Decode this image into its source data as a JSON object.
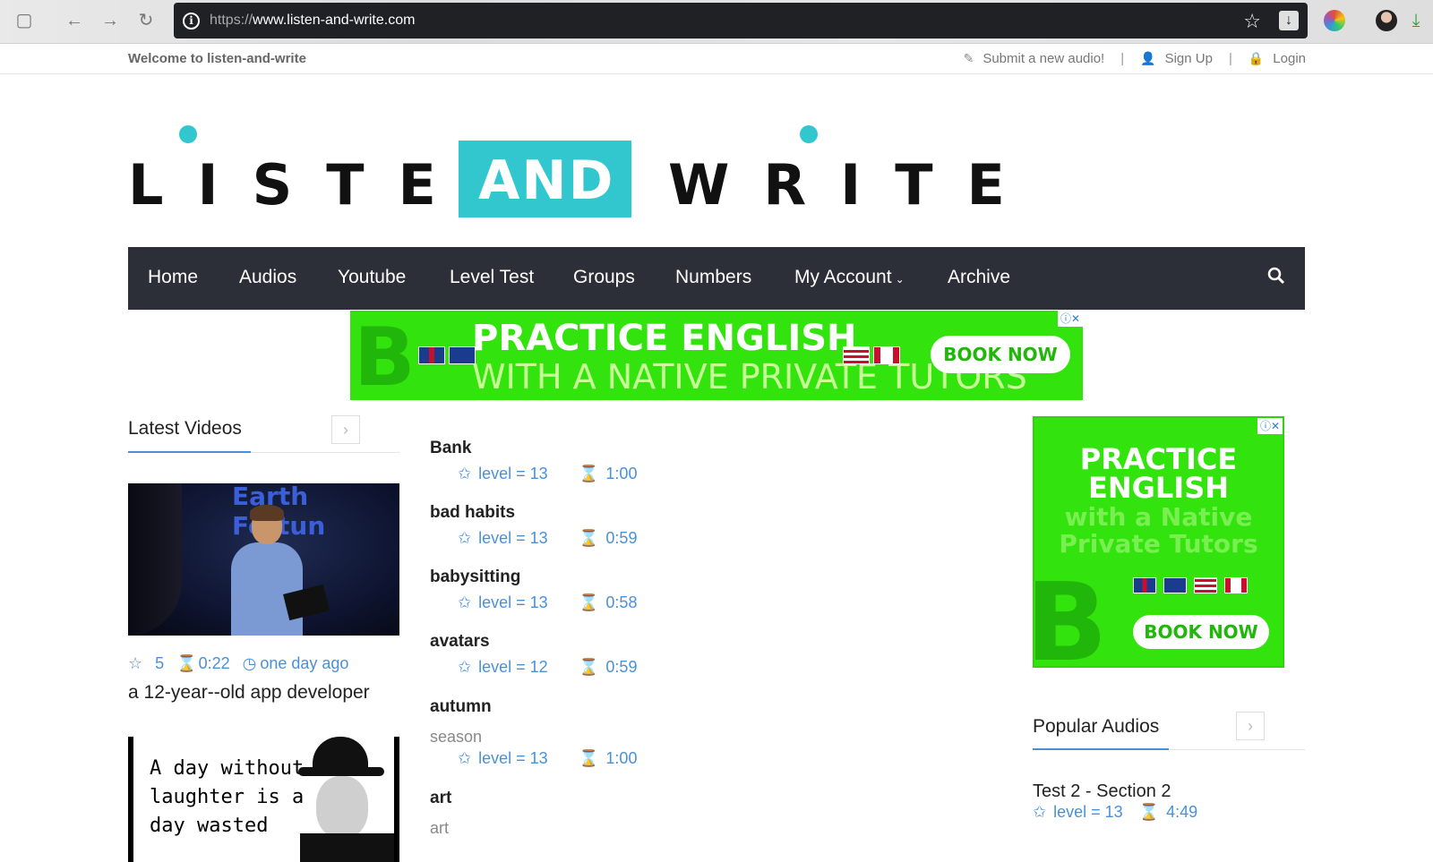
{
  "browser": {
    "url_protocol": "https://",
    "url_host": "www.listen-and-write.com"
  },
  "topbar": {
    "welcome": "Welcome to listen-and-write",
    "submit": "Submit a new audio!",
    "signup": "Sign Up",
    "login": "Login"
  },
  "logo": {
    "word1": "LISTEN",
    "word2": "AND",
    "word3": "WRITE"
  },
  "nav": {
    "items": [
      "Home",
      "Audios",
      "Youtube",
      "Level Test",
      "Groups",
      "Numbers",
      "My Account",
      "Archive"
    ]
  },
  "ad_banner": {
    "headline": "PRACTICE ENGLISH",
    "subline": "WITH A NATIVE PRIVATE TUTORS",
    "cta": "BOOK NOW"
  },
  "ad_side": {
    "headline1": "PRACTICE",
    "headline2": "ENGLISH",
    "sub1": "with a Native",
    "sub2": "Private Tutors",
    "cta": "BOOK NOW"
  },
  "latest_videos": {
    "title": "Latest Videos",
    "video1": {
      "banner": "Earth Fortun",
      "rating": "5",
      "duration": "0:22",
      "ago": "one day ago",
      "title": "a 12-year--old app developer"
    },
    "video2": {
      "quote_line1": "A day without",
      "quote_line2": "laughter is a",
      "quote_line3": "day wasted"
    }
  },
  "audios": [
    {
      "title": "Bank",
      "subtitle": "",
      "level": "level = 13",
      "duration": "1:00"
    },
    {
      "title": "bad habits",
      "subtitle": "",
      "level": "level = 13",
      "duration": "0:59"
    },
    {
      "title": "babysitting",
      "subtitle": "",
      "level": "level = 13",
      "duration": "0:58"
    },
    {
      "title": "avatars",
      "subtitle": "",
      "level": "level = 12",
      "duration": "0:59"
    },
    {
      "title": "autumn",
      "subtitle": "season",
      "level": "level = 13",
      "duration": "1:00"
    },
    {
      "title": "art",
      "subtitle": "art",
      "level": "",
      "duration": ""
    }
  ],
  "popular_audios": {
    "title": "Popular Audios",
    "item1": {
      "title": "Test 2 - Section 2",
      "level": "level = 13",
      "duration": "4:49"
    }
  }
}
